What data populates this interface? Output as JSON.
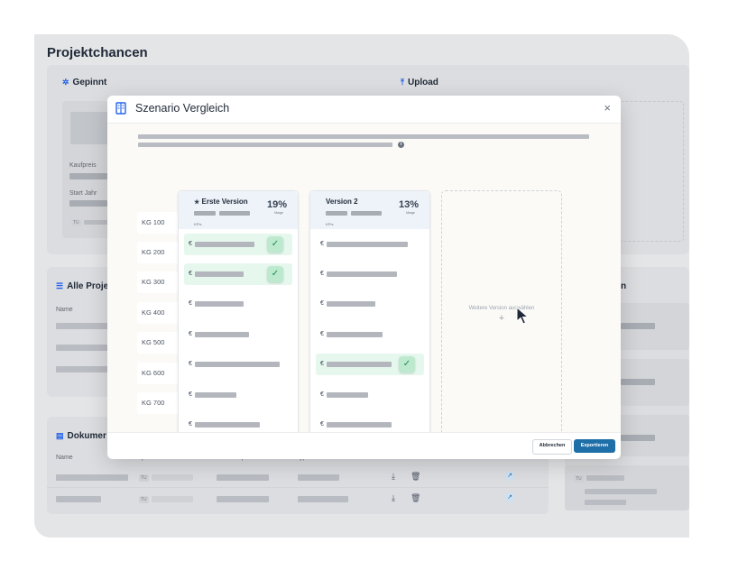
{
  "page": {
    "title": "Projektchancen"
  },
  "sections": {
    "pinned": "Gepinnt",
    "upload": "Upload",
    "all_projects": "Alle Proje",
    "documents": "Dokumer",
    "right_partial": "n"
  },
  "pinned_card": {
    "kaufpreis": "Kaufpreis",
    "start_jahr": "Start Jahr",
    "chip": "TU"
  },
  "table": {
    "name_header": "Name",
    "docs_headers": [
      "Name",
      "Uploader",
      "Datum Upload",
      "Typ",
      "Aktionen"
    ],
    "chip": "TU"
  },
  "modal": {
    "title": "Szenario Vergleich",
    "close": "×",
    "info": "i",
    "row_labels": [
      "KG 100",
      "KG 200",
      "KG 300",
      "KG 400",
      "KG 500",
      "KG 600",
      "KG 700"
    ],
    "versions": [
      {
        "name": "Erste Version",
        "starred": true,
        "percent": "19%",
        "marge": "Marge",
        "kpis": "KPIs",
        "euro": "€",
        "selected_rows": [
          0,
          1
        ]
      },
      {
        "name": "Version 2",
        "starred": false,
        "percent": "13%",
        "marge": "Marge",
        "kpis": "KPIs",
        "euro": "€",
        "selected_rows": [
          4
        ]
      }
    ],
    "add_version_label": "Weitere Version auswählen",
    "add_plus": "+",
    "cancel_label": "Abbrechen",
    "export_label": "Exportieren"
  },
  "icons": {
    "pin": "pin-icon",
    "upload": "upload-icon",
    "list": "list-check-icon",
    "document": "document-icon",
    "compare": "compare-icon",
    "close": "close-icon",
    "check": "check-icon",
    "download": "download-icon",
    "trash": "trash-icon",
    "external": "external-link-icon",
    "cursor": "mouse-cursor-icon",
    "star": "star-icon"
  },
  "colors": {
    "accent": "#1e6fa8",
    "selected_row": "#e6f7ee",
    "check": "#1f8a4c",
    "header_tint": "#eef3fa"
  }
}
